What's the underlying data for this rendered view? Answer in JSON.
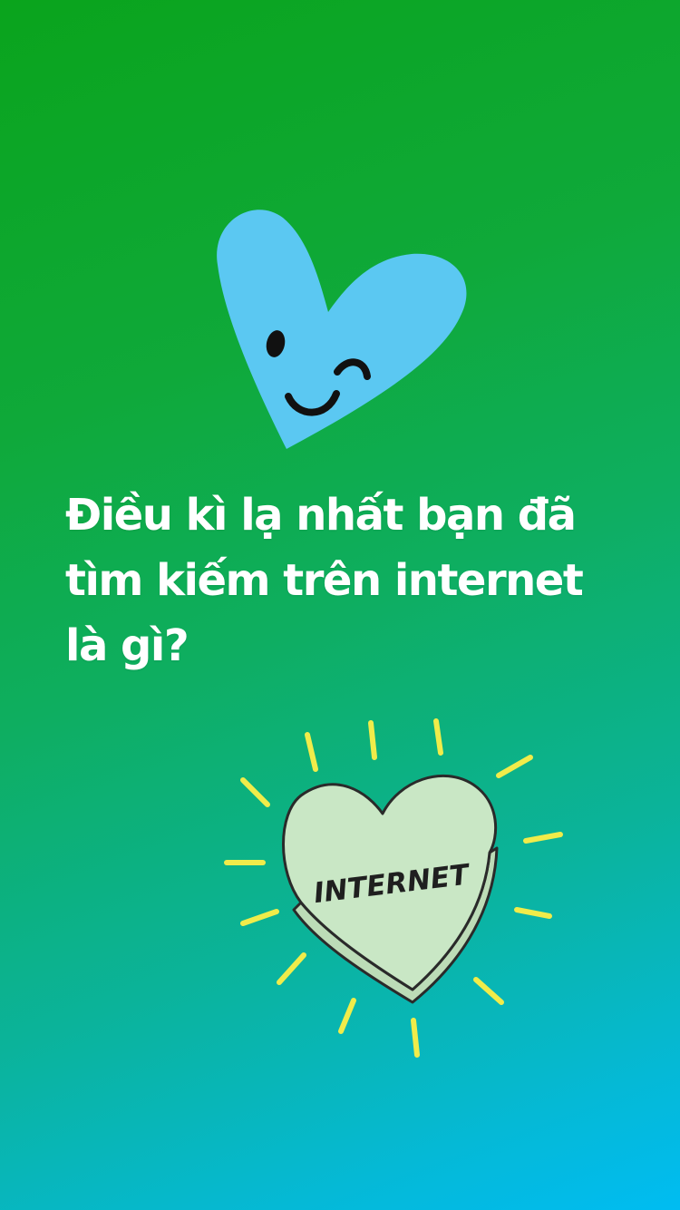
{
  "story": {
    "question_lines": [
      "Điều kì lạ nhất bạn đã",
      "tìm kiếm trên internet",
      "là gì?"
    ],
    "sticker_text": "INTERNET"
  },
  "icons": {
    "top": "winking-heart-icon",
    "bottom": "internet-candy-heart-icon"
  },
  "colors": {
    "gradient_start": "#0aa41c",
    "gradient_end": "#00bcf2",
    "heart_blue": "#5bc8f2",
    "candy_heart": "#c9e7c5",
    "rays": "#f0ec4a"
  }
}
